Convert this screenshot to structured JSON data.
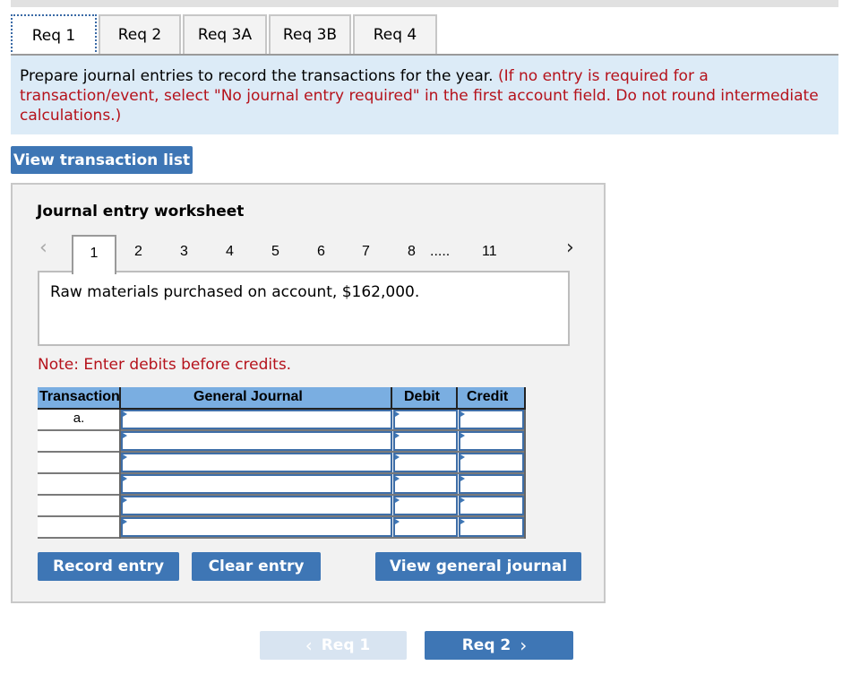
{
  "tabs": [
    {
      "label": "Req 1",
      "active": true
    },
    {
      "label": "Req 2",
      "active": false
    },
    {
      "label": "Req 3A",
      "active": false
    },
    {
      "label": "Req 3B",
      "active": false
    },
    {
      "label": "Req 4",
      "active": false
    }
  ],
  "instructions": {
    "main": "Prepare journal entries to record the transactions for the year.",
    "note": "(If no entry is required for a transaction/event, select \"No journal entry required\" in the first account field. Do not round intermediate calculations.)"
  },
  "view_transaction_list_label": "View transaction list",
  "worksheet": {
    "title": "Journal entry worksheet",
    "pager": {
      "prev_icon": "chevron-left-icon",
      "next_icon": "chevron-right-icon",
      "active_page": "1",
      "pages": [
        "2",
        "3",
        "4",
        "5",
        "6",
        "7",
        "8"
      ],
      "ellipsis": ".....",
      "last_page": "11"
    },
    "description": "Raw materials purchased on account, $162,000.",
    "note": "Note: Enter debits before credits.",
    "table": {
      "headers": {
        "transaction": "Transaction",
        "general_journal": "General Journal",
        "debit": "Debit",
        "credit": "Credit"
      },
      "rows": [
        {
          "transaction": "a.",
          "account": "",
          "debit": "",
          "credit": ""
        },
        {
          "transaction": "",
          "account": "",
          "debit": "",
          "credit": ""
        },
        {
          "transaction": "",
          "account": "",
          "debit": "",
          "credit": ""
        },
        {
          "transaction": "",
          "account": "",
          "debit": "",
          "credit": ""
        },
        {
          "transaction": "",
          "account": "",
          "debit": "",
          "credit": ""
        },
        {
          "transaction": "",
          "account": "",
          "debit": "",
          "credit": ""
        }
      ]
    },
    "buttons": {
      "record": "Record entry",
      "clear": "Clear entry",
      "view_general_journal": "View general journal"
    }
  },
  "nav": {
    "prev_label": "Req 1",
    "next_label": "Req 2",
    "prev_chevron": "‹",
    "next_chevron": "›"
  },
  "colors": {
    "accent": "#3e76b5",
    "instruction_bg": "#dcebf7",
    "warning_red": "#b5121b",
    "table_header": "#7aaee1"
  }
}
